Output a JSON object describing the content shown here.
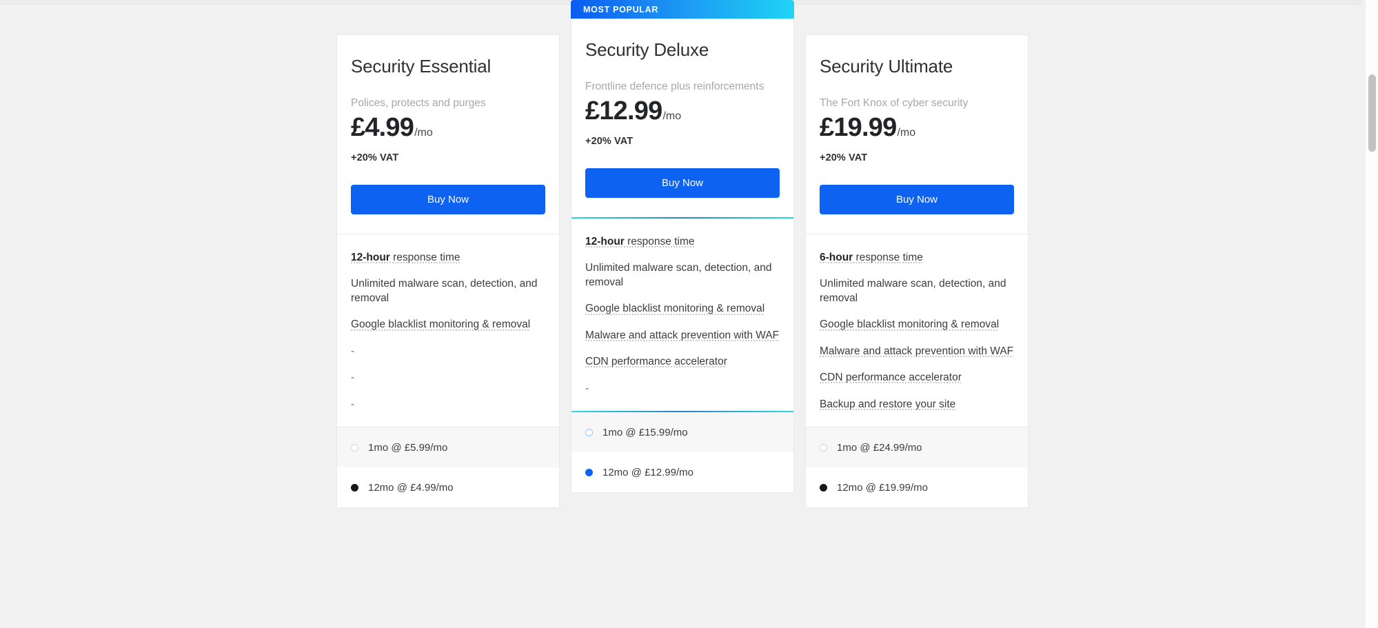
{
  "colors": {
    "page_bg": "#f1f1f1",
    "card_bg": "#ffffff",
    "button_blue": "#0d62f2",
    "badge_gradient_from": "#0b5cf0",
    "badge_gradient_to": "#20d4f5",
    "accent_teal": "#2bd8e0",
    "muted_text": "#a6a8ab"
  },
  "badge": {
    "label": "MOST POPULAR"
  },
  "plans": [
    {
      "id": "security-essential",
      "title": "Security Essential",
      "tagline": "Polices, protects and purges",
      "price_amount": "£4.99",
      "price_period": "/mo",
      "vat_note": "+20% VAT",
      "buy_label": "Buy Now",
      "featured": false,
      "features": [
        {
          "lead": "12-hour",
          "rest": " response time",
          "tooltip": true,
          "empty": false
        },
        {
          "lead": "",
          "rest": "Unlimited malware scan, detection, and removal",
          "tooltip": false,
          "empty": false
        },
        {
          "lead": "",
          "rest": "Google blacklist monitoring & removal",
          "tooltip": true,
          "empty": false
        },
        {
          "lead": "",
          "rest": "-",
          "tooltip": false,
          "empty": true
        },
        {
          "lead": "",
          "rest": "-",
          "tooltip": false,
          "empty": true
        },
        {
          "lead": "",
          "rest": "-",
          "tooltip": false,
          "empty": true
        }
      ],
      "terms": [
        {
          "label": "1mo @ £5.99/mo",
          "selected": false
        },
        {
          "label": "12mo @ £4.99/mo",
          "selected": true
        }
      ]
    },
    {
      "id": "security-deluxe",
      "title": "Security Deluxe",
      "tagline": "Frontline defence plus reinforcements",
      "price_amount": "£12.99",
      "price_period": "/mo",
      "vat_note": "+20% VAT",
      "buy_label": "Buy Now",
      "featured": true,
      "features": [
        {
          "lead": "12-hour",
          "rest": " response time",
          "tooltip": true,
          "empty": false
        },
        {
          "lead": "",
          "rest": "Unlimited malware scan, detection, and removal",
          "tooltip": false,
          "empty": false
        },
        {
          "lead": "",
          "rest": "Google blacklist monitoring & removal",
          "tooltip": true,
          "empty": false
        },
        {
          "lead": "",
          "rest": "Malware and attack prevention with WAF",
          "tooltip": true,
          "empty": false
        },
        {
          "lead": "",
          "rest": "CDN performance accelerator",
          "tooltip": true,
          "empty": false
        },
        {
          "lead": "",
          "rest": "-",
          "tooltip": false,
          "empty": true
        }
      ],
      "terms": [
        {
          "label": "1mo @ £15.99/mo",
          "selected": false
        },
        {
          "label": "12mo @ £12.99/mo",
          "selected": true
        }
      ]
    },
    {
      "id": "security-ultimate",
      "title": "Security Ultimate",
      "tagline": "The Fort Knox of cyber security",
      "price_amount": "£19.99",
      "price_period": "/mo",
      "vat_note": "+20% VAT",
      "buy_label": "Buy Now",
      "featured": false,
      "features": [
        {
          "lead": "6-hour",
          "rest": " response time",
          "tooltip": true,
          "empty": false
        },
        {
          "lead": "",
          "rest": "Unlimited malware scan, detection, and removal",
          "tooltip": false,
          "empty": false
        },
        {
          "lead": "",
          "rest": "Google blacklist monitoring & removal",
          "tooltip": true,
          "empty": false
        },
        {
          "lead": "",
          "rest": "Malware and attack prevention with WAF",
          "tooltip": true,
          "empty": false
        },
        {
          "lead": "",
          "rest": "CDN performance accelerator",
          "tooltip": true,
          "empty": false
        },
        {
          "lead": "",
          "rest": "Backup and restore your site",
          "tooltip": true,
          "empty": false
        }
      ],
      "terms": [
        {
          "label": "1mo @ £24.99/mo",
          "selected": false
        },
        {
          "label": "12mo @ £19.99/mo",
          "selected": true
        }
      ]
    }
  ]
}
